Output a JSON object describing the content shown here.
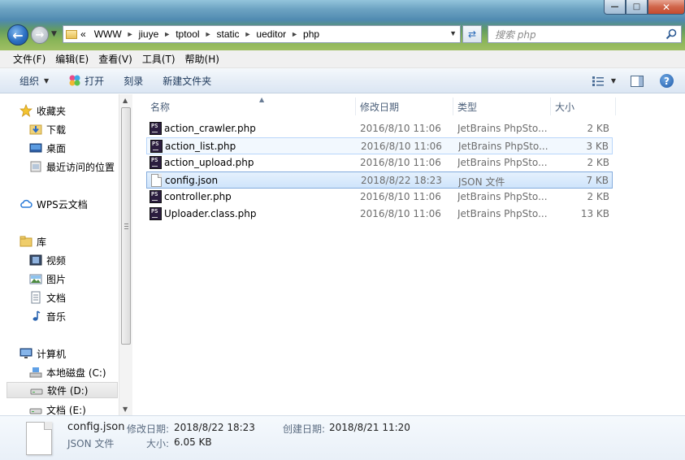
{
  "window": {
    "controls": {
      "minimize": "—",
      "maximize": "□",
      "close": "✕"
    }
  },
  "nav": {
    "address_segments": [
      "«",
      "WWW",
      "jiuye",
      "tptool",
      "static",
      "ueditor",
      "php"
    ],
    "search_placeholder": "搜索 php"
  },
  "menubar": {
    "items": [
      "文件(F)",
      "编辑(E)",
      "查看(V)",
      "工具(T)",
      "帮助(H)"
    ]
  },
  "commandbar": {
    "organize": "组织",
    "open": "打开",
    "burn": "刻录",
    "new_folder": "新建文件夹"
  },
  "sidebar": {
    "favorites": "收藏夹",
    "downloads": "下载",
    "desktop": "桌面",
    "recent": "最近访问的位置",
    "wps": "WPS云文档",
    "libraries": "库",
    "videos": "视频",
    "pictures": "图片",
    "documents": "文档",
    "music": "音乐",
    "computer": "计算机",
    "drive_c": "本地磁盘 (C:)",
    "drive_d": "软件 (D:)",
    "drive_e": "文档 (E:)"
  },
  "columns": {
    "name": "名称",
    "date": "修改日期",
    "type": "类型",
    "size": "大小"
  },
  "files": [
    {
      "name": "action_crawler.php",
      "date": "2016/8/10 11:06",
      "type": "JetBrains PhpSto...",
      "size": "2 KB",
      "icon": "phpstorm-file-icon",
      "state": "normal"
    },
    {
      "name": "action_list.php",
      "date": "2016/8/10 11:06",
      "type": "JetBrains PhpSto...",
      "size": "3 KB",
      "icon": "phpstorm-file-icon",
      "state": "hover"
    },
    {
      "name": "action_upload.php",
      "date": "2016/8/10 11:06",
      "type": "JetBrains PhpSto...",
      "size": "2 KB",
      "icon": "phpstorm-file-icon",
      "state": "normal"
    },
    {
      "name": "config.json",
      "date": "2018/8/22 18:23",
      "type": "JSON 文件",
      "size": "7 KB",
      "icon": "blank-document-icon",
      "state": "selected"
    },
    {
      "name": "controller.php",
      "date": "2016/8/10 11:06",
      "type": "JetBrains PhpSto...",
      "size": "2 KB",
      "icon": "phpstorm-file-icon",
      "state": "normal"
    },
    {
      "name": "Uploader.class.php",
      "date": "2016/8/10 11:06",
      "type": "JetBrains PhpSto...",
      "size": "13 KB",
      "icon": "phpstorm-file-icon",
      "state": "normal"
    }
  ],
  "details": {
    "filename": "config.json",
    "filetype": "JSON 文件",
    "modified_label": "修改日期:",
    "modified_value": "2018/8/22 18:23",
    "created_label": "创建日期:",
    "created_value": "2018/8/21 11:20",
    "size_label": "大小:",
    "size_value": "6.05 KB"
  },
  "colors": {
    "selection_border": "#84acdd",
    "hover_border": "#b8d6fb",
    "command_text": "#1e395b"
  }
}
